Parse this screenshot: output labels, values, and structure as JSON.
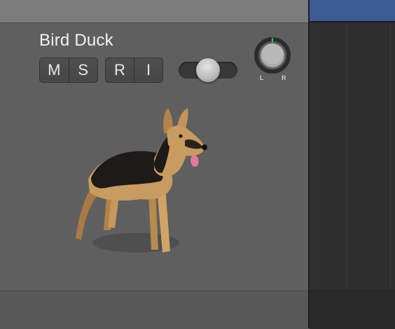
{
  "track": {
    "name": "Bird Duck",
    "buttons": {
      "mute": "M",
      "solo": "S",
      "record": "R",
      "input": "I"
    },
    "volume_level": 0.5,
    "pan": {
      "value": 0,
      "left_label": "L",
      "right_label": "R"
    },
    "icon": "german-shepherd-dog"
  },
  "colors": {
    "region": "#3b5d93",
    "pan_indicator": "#35c24a",
    "header_bg": "#5f5f5f",
    "text": "#f3f3f3"
  }
}
